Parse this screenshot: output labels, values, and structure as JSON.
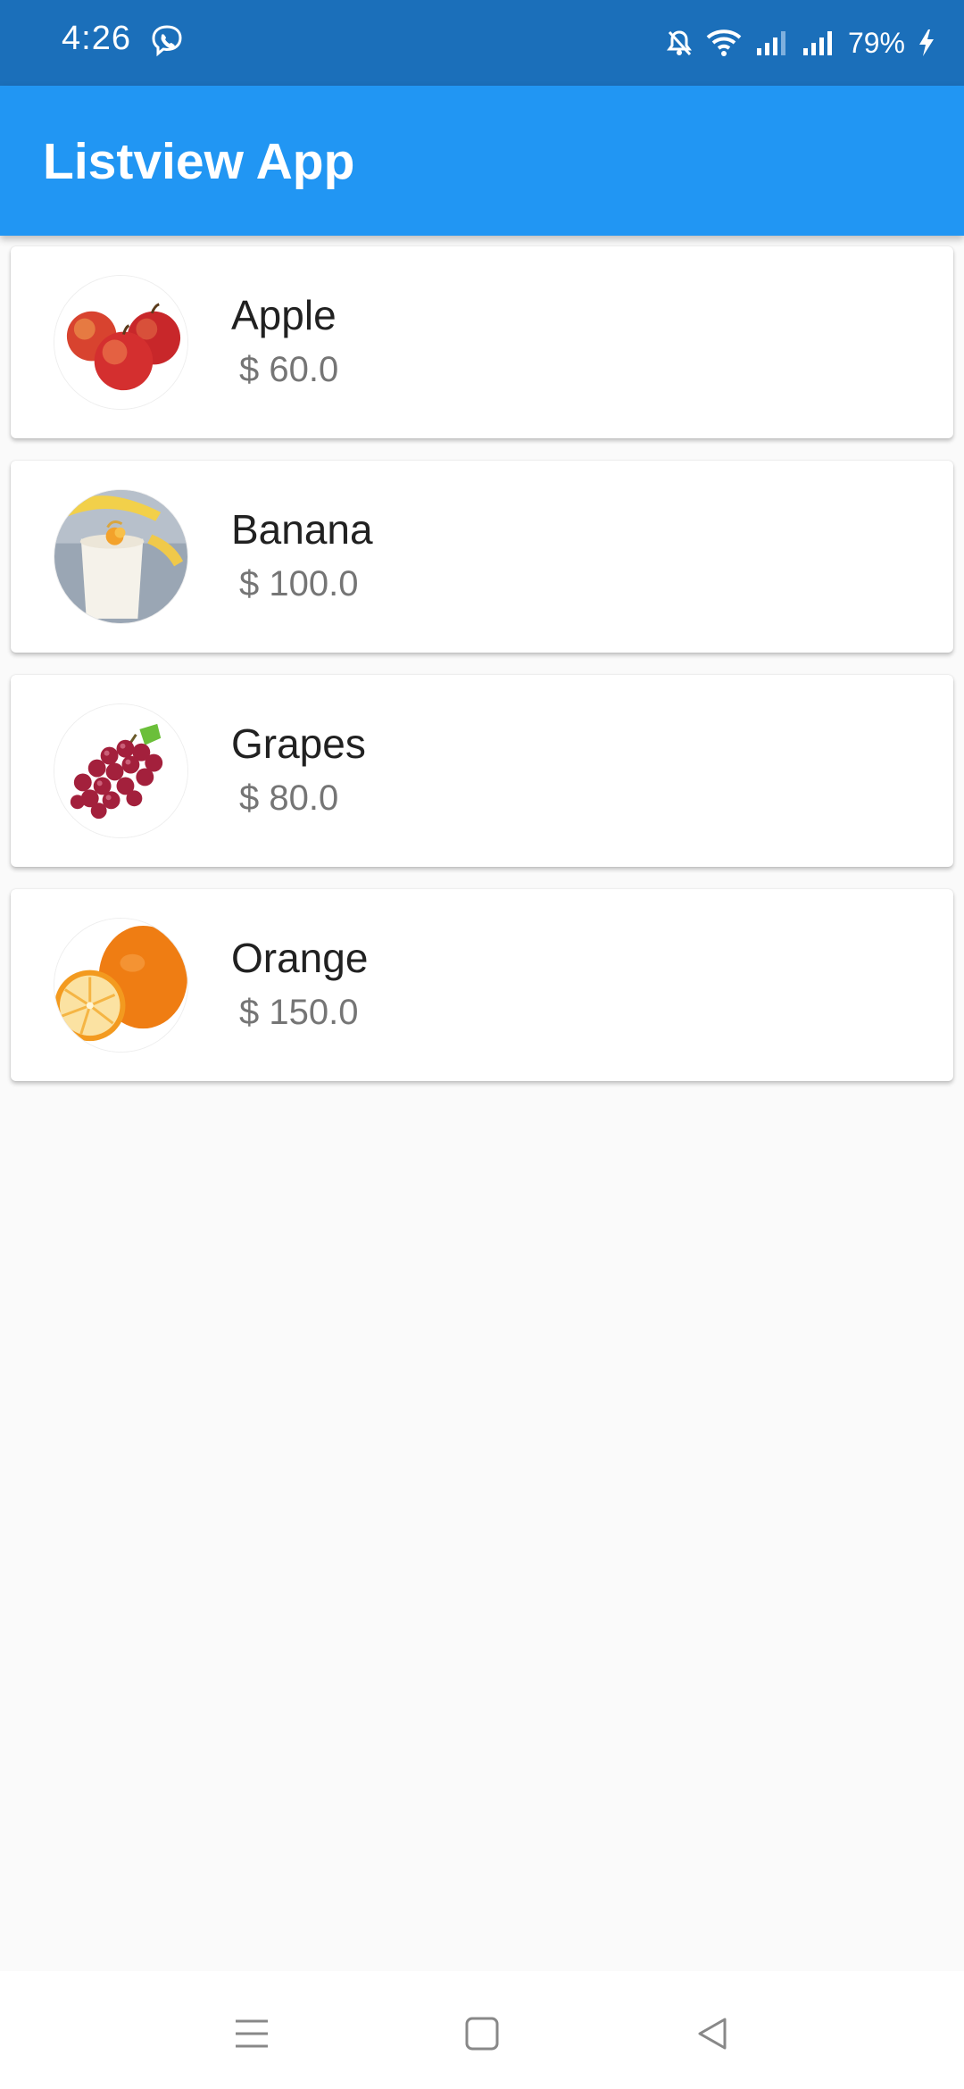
{
  "status_bar": {
    "time": "4:26",
    "battery": "79%",
    "icons": [
      "viber-icon",
      "bell-off-icon",
      "wifi-icon",
      "signal-icon",
      "signal-icon",
      "charging-icon"
    ]
  },
  "app_bar": {
    "title": "Listview App",
    "color": "#2196f3"
  },
  "items": [
    {
      "name": "Apple",
      "price": "$ 60.0",
      "image": "apple-image"
    },
    {
      "name": "Banana",
      "price": "$ 100.0",
      "image": "banana-image"
    },
    {
      "name": "Grapes",
      "price": "$ 80.0",
      "image": "grapes-image"
    },
    {
      "name": "Orange",
      "price": "$ 150.0",
      "image": "orange-image"
    }
  ],
  "nav_bar": {
    "buttons": [
      "menu-icon",
      "home-icon",
      "back-icon"
    ]
  }
}
